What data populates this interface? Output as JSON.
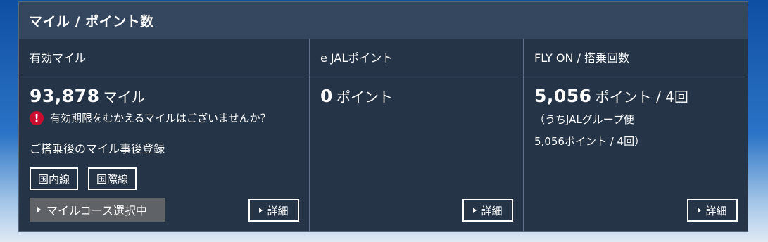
{
  "panel": {
    "title": "マイル / ポイント数"
  },
  "miles": {
    "header": "有効マイル",
    "value": "93,878",
    "unit": "マイル",
    "warning": "有効期限をむかえるマイルはございませんか？",
    "retro_label": "ご搭乗後のマイル事後登録",
    "domestic_button": "国内線",
    "international_button": "国際線",
    "course_label": "マイルコース選択中",
    "detail_label": "詳細"
  },
  "ejal": {
    "header": "e JALポイント",
    "value": "0",
    "unit": "ポイント",
    "detail_label": "詳細"
  },
  "flyon": {
    "header": "FLY ON / 搭乗回数",
    "value": "5,056",
    "unit": "ポイント / 4回",
    "group_line1": "（うちJALグループ便",
    "group_line2": "5,056ポイント / 4回）",
    "detail_label": "詳細"
  }
}
